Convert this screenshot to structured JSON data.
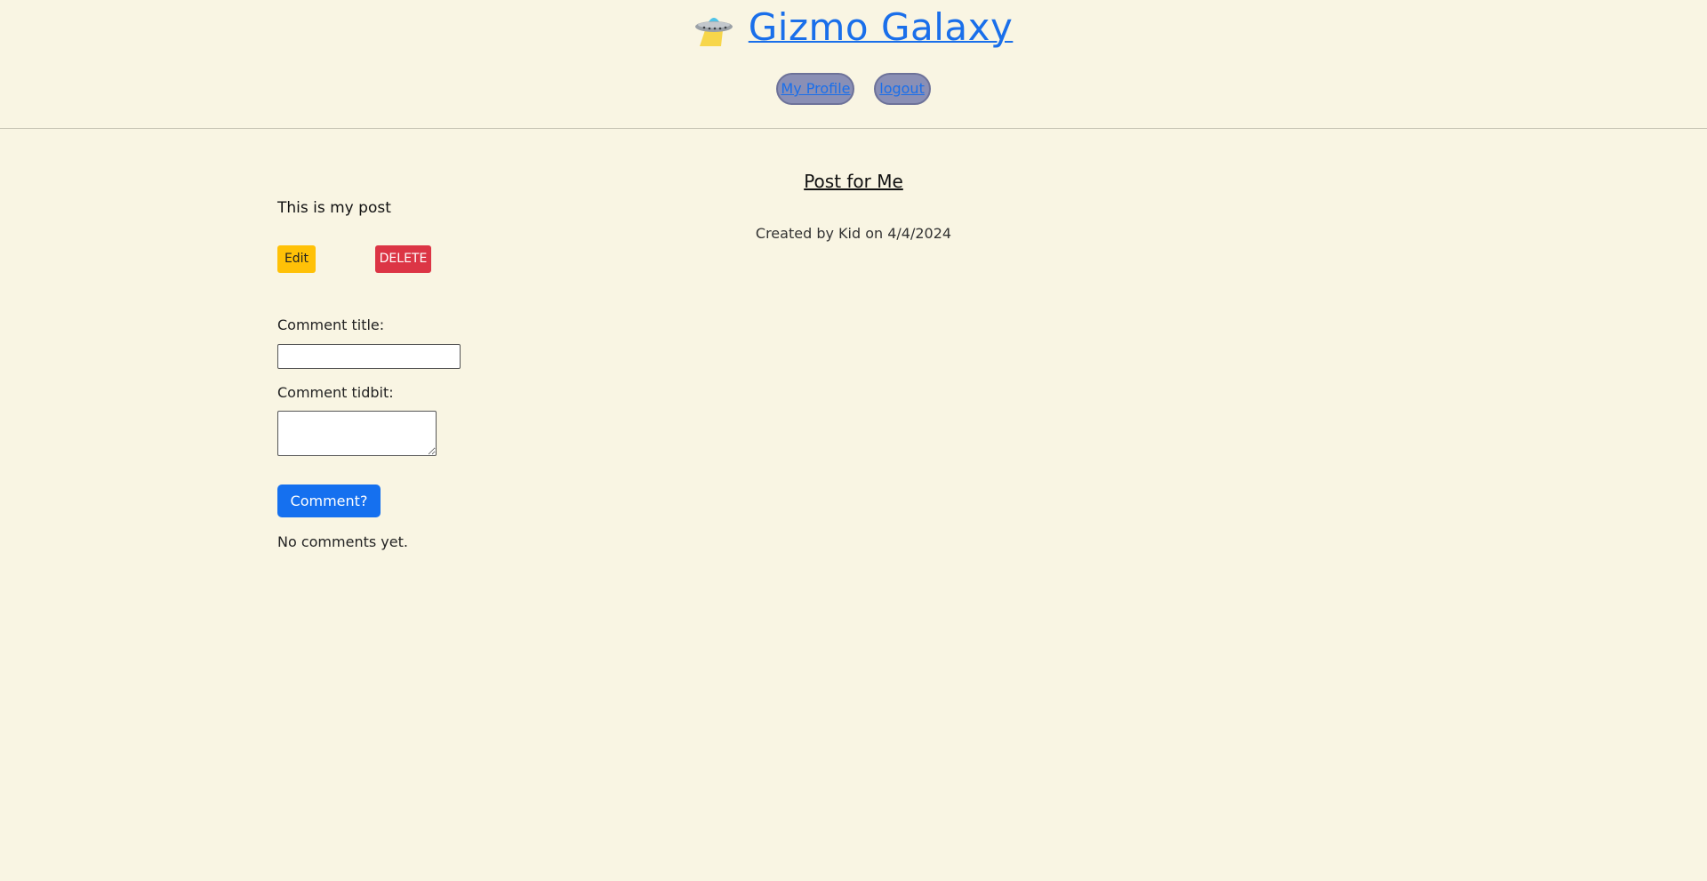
{
  "header": {
    "brand": "Gizmo Galaxy",
    "brand_icon": "ufo-icon",
    "nav": {
      "profile": "My Profile",
      "logout": "logout"
    }
  },
  "post": {
    "title": "Post for Me",
    "meta": "Created by Kid on 4/4/2024",
    "body": "This is my post",
    "edit_label": "Edit",
    "delete_label": "DELETE"
  },
  "comment_form": {
    "title_label": "Comment title:",
    "title_value": "",
    "tidbit_label": "Comment tidbit:",
    "tidbit_value": "",
    "submit_label": "Comment?"
  },
  "comments": {
    "empty_text": "No comments yet."
  },
  "colors": {
    "background": "#f9f5e3",
    "link": "#1a6fea",
    "edit": "#ffc107",
    "delete": "#dc3545",
    "primary": "#1570ef",
    "nav_pill": "#8a8fb5"
  }
}
